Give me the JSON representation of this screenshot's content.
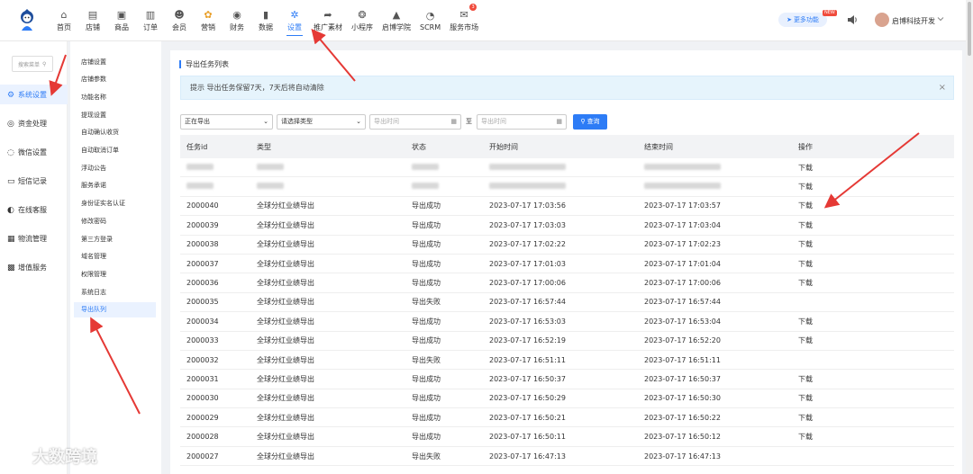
{
  "nav": [
    {
      "label": "首页",
      "icon": "home-icon"
    },
    {
      "label": "店铺",
      "icon": "store-icon"
    },
    {
      "label": "商品",
      "icon": "goods-icon"
    },
    {
      "label": "订单",
      "icon": "order-icon"
    },
    {
      "label": "会员",
      "icon": "member-icon"
    },
    {
      "label": "营销",
      "icon": "marketing-icon"
    },
    {
      "label": "财务",
      "icon": "finance-icon"
    },
    {
      "label": "数据",
      "icon": "chart-icon"
    },
    {
      "label": "设置",
      "icon": "gear-icon"
    },
    {
      "label": "推广素材",
      "icon": "share-icon"
    },
    {
      "label": "小程序",
      "icon": "miniapp-icon"
    },
    {
      "label": "启博学院",
      "icon": "academy-icon"
    },
    {
      "label": "SCRM",
      "icon": "scrm-icon"
    },
    {
      "label": "服务市场",
      "icon": "market-icon"
    }
  ],
  "header": {
    "more_label": "更多功能",
    "new_badge": "NEW",
    "username": "启博科技开发",
    "market_badge": "3"
  },
  "side1": {
    "search_placeholder": "搜索菜单",
    "items": [
      {
        "label": "系统设置",
        "icon": "gear-circle-icon"
      },
      {
        "label": "资金处理",
        "icon": "money-icon"
      },
      {
        "label": "微信设置",
        "icon": "wechat-icon"
      },
      {
        "label": "短信记录",
        "icon": "sms-icon"
      },
      {
        "label": "在线客服",
        "icon": "service-icon"
      },
      {
        "label": "物流管理",
        "icon": "logistics-icon"
      },
      {
        "label": "增值服务",
        "icon": "value-added-icon"
      }
    ]
  },
  "side2": {
    "items": [
      "店铺设置",
      "店铺参数",
      "功能名称",
      "提现设置",
      "自动确认收货",
      "自动取消订单",
      "浮动公告",
      "服务承诺",
      "身份证实名认证",
      "修改密码",
      "第三方登录",
      "域名管理",
      "权限管理",
      "系统日志",
      "导出队列"
    ]
  },
  "main": {
    "title": "导出任务列表",
    "tip": "提示  导出任务保留7天，7天后将自动清除",
    "close": "×",
    "status_select": "正在导出",
    "type_select": "请选择类型",
    "date_placeholder": "导出时间",
    "to": "至",
    "query": "查询"
  },
  "table": {
    "headers": [
      "任务id",
      "类型",
      "状态",
      "开始时间",
      "结束时间",
      "操作"
    ],
    "blurred_rows": [
      {
        "action": "下载"
      },
      {
        "action": "下载"
      }
    ],
    "rows": [
      {
        "id": "2000040",
        "type": "全球分红业绩导出",
        "status": "导出成功",
        "start": "2023-07-17 17:03:56",
        "end": "2023-07-17 17:03:57",
        "action": "下载"
      },
      {
        "id": "2000039",
        "type": "全球分红业绩导出",
        "status": "导出成功",
        "start": "2023-07-17 17:03:03",
        "end": "2023-07-17 17:03:04",
        "action": "下载"
      },
      {
        "id": "2000038",
        "type": "全球分红业绩导出",
        "status": "导出成功",
        "start": "2023-07-17 17:02:22",
        "end": "2023-07-17 17:02:23",
        "action": "下载"
      },
      {
        "id": "2000037",
        "type": "全球分红业绩导出",
        "status": "导出成功",
        "start": "2023-07-17 17:01:03",
        "end": "2023-07-17 17:01:04",
        "action": "下载"
      },
      {
        "id": "2000036",
        "type": "全球分红业绩导出",
        "status": "导出成功",
        "start": "2023-07-17 17:00:06",
        "end": "2023-07-17 17:00:06",
        "action": "下载"
      },
      {
        "id": "2000035",
        "type": "全球分红业绩导出",
        "status": "导出失败",
        "start": "2023-07-17 16:57:44",
        "end": "2023-07-17 16:57:44",
        "action": ""
      },
      {
        "id": "2000034",
        "type": "全球分红业绩导出",
        "status": "导出成功",
        "start": "2023-07-17 16:53:03",
        "end": "2023-07-17 16:53:04",
        "action": "下载"
      },
      {
        "id": "2000033",
        "type": "全球分红业绩导出",
        "status": "导出成功",
        "start": "2023-07-17 16:52:19",
        "end": "2023-07-17 16:52:20",
        "action": "下载"
      },
      {
        "id": "2000032",
        "type": "全球分红业绩导出",
        "status": "导出失败",
        "start": "2023-07-17 16:51:11",
        "end": "2023-07-17 16:51:11",
        "action": ""
      },
      {
        "id": "2000031",
        "type": "全球分红业绩导出",
        "status": "导出成功",
        "start": "2023-07-17 16:50:37",
        "end": "2023-07-17 16:50:37",
        "action": "下载"
      },
      {
        "id": "2000030",
        "type": "全球分红业绩导出",
        "status": "导出成功",
        "start": "2023-07-17 16:50:29",
        "end": "2023-07-17 16:50:30",
        "action": "下载"
      },
      {
        "id": "2000029",
        "type": "全球分红业绩导出",
        "status": "导出成功",
        "start": "2023-07-17 16:50:21",
        "end": "2023-07-17 16:50:22",
        "action": "下载"
      },
      {
        "id": "2000028",
        "type": "全球分红业绩导出",
        "status": "导出成功",
        "start": "2023-07-17 16:50:11",
        "end": "2023-07-17 16:50:12",
        "action": "下载"
      },
      {
        "id": "2000027",
        "type": "全球分红业绩导出",
        "status": "导出失败",
        "start": "2023-07-17 16:47:13",
        "end": "2023-07-17 16:47:13",
        "action": ""
      }
    ]
  },
  "watermark": "大数跨境",
  "colors": {
    "accent": "#2d7cf6",
    "arrow": "#e53935"
  }
}
